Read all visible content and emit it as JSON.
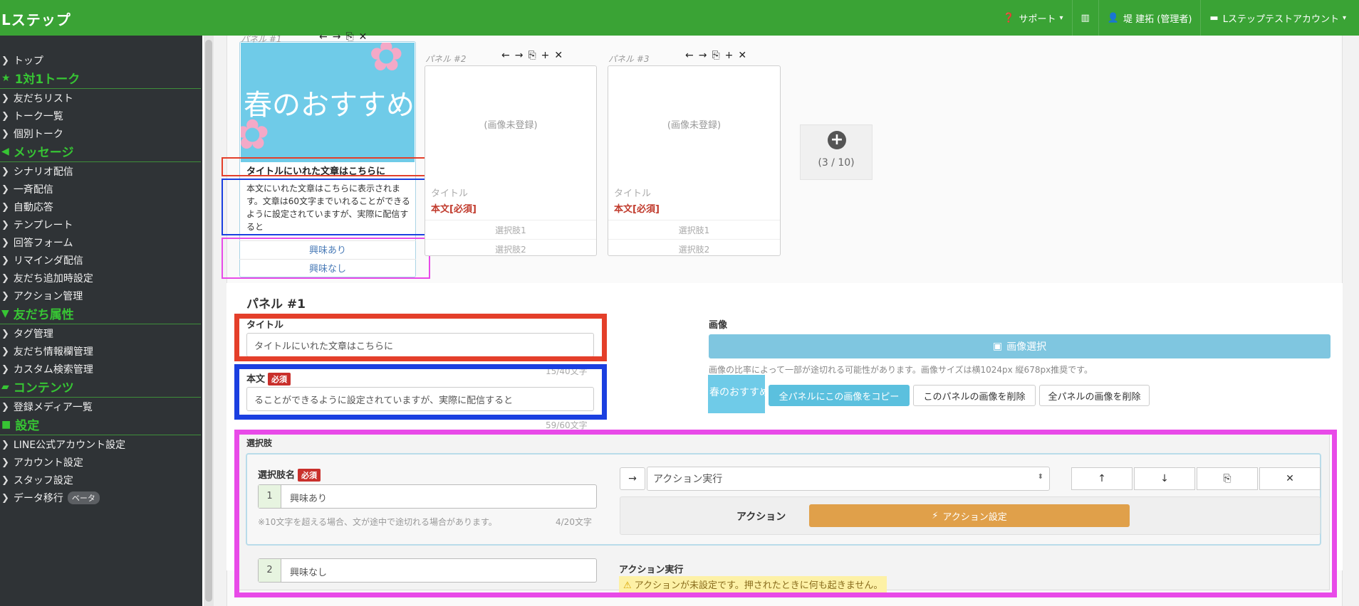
{
  "app": {
    "brand": "Lステップ"
  },
  "topnav": {
    "support": "サポート",
    "user": "堤 建拓 (管理者)",
    "account": "Lステップテストアカウント"
  },
  "sidebar": {
    "top": "トップ",
    "sec_talk": "1対1トーク",
    "friends_list": "友だちリスト",
    "talk_list": "トーク一覧",
    "individual_talk": "個別トーク",
    "sec_message": "メッセージ",
    "scenario": "シナリオ配信",
    "broadcast": "一斉配信",
    "auto_reply": "自動応答",
    "template": "テンプレート",
    "answer_form": "回答フォーム",
    "reminder": "リマインダ配信",
    "friend_add_setting": "友だち追加時設定",
    "action_mgmt": "アクション管理",
    "sec_attr": "友だち属性",
    "tag_mgmt": "タグ管理",
    "friend_info_mgmt": "友だち情報欄管理",
    "custom_search_mgmt": "カスタム検索管理",
    "sec_contents": "コンテンツ",
    "media_list": "登録メディア一覧",
    "sec_settings": "設定",
    "line_account_setting": "LINE公式アカウント設定",
    "account_setting": "アカウント設定",
    "staff_setting": "スタッフ設定",
    "data_migration": "データ移行",
    "beta": "ベータ"
  },
  "preview": {
    "panel1_label": "パネル #1",
    "panel2_label": "パネル #2",
    "panel3_label": "パネル #3",
    "image_text": "春のおすすめ",
    "no_image": "(画像未登録)",
    "title_placeholder": "タイトル",
    "body_required": "本文[必須]",
    "choice1_placeholder": "選択肢1",
    "choice2_placeholder": "選択肢2",
    "p1_title": "タイトルにいれた文章はこちらに",
    "p1_body": "本文にいれた文章はこちらに表示されます。文章は60文字までいれることができるように設定されていますが、実際に配信すると",
    "p1_choice1": "興味あり",
    "p1_choice2": "興味なし",
    "add_count": "(3 / 10)"
  },
  "form": {
    "section_title": "パネル #1",
    "title_label": "タイトル",
    "title_value": "タイトルにいれた文章はこちらに",
    "title_counter": "15/40文字",
    "body_label": "本文",
    "required": "必須",
    "body_value": "ることができるように設定されていますが、実際に配信すると",
    "body_counter": "59/60文字",
    "image_label": "画像",
    "image_select": "画像選択",
    "image_note": "画像の比率によって一部が途切れる可能性があります。画像サイズは横1024px 縦678px推奨です。",
    "copy_all": "全パネルにこの画像をコピー",
    "delete_this": "このパネルの画像を削除",
    "delete_all": "全パネルの画像を削除"
  },
  "choices": {
    "section_label": "選択肢",
    "name_label": "選択肢名",
    "choice1_num": "1",
    "choice1_value": "興味あり",
    "note": "※10文字を超える場合、文が途中で途切れる場合があります。",
    "counter": "4/20文字",
    "action_select": "アクション実行",
    "action_label": "アクション",
    "action_setting": "アクション設定",
    "choice2_num": "2",
    "choice2_value": "興味なし",
    "action_exec_label": "アクション実行",
    "warning": "アクションが未設定です。押されたときに何も起きません。"
  },
  "icons": {
    "left": "←",
    "right": "→",
    "copy": "⎘",
    "plus": "+",
    "close": "✕",
    "up": "↑",
    "down": "↓",
    "bolt": "⚡"
  }
}
